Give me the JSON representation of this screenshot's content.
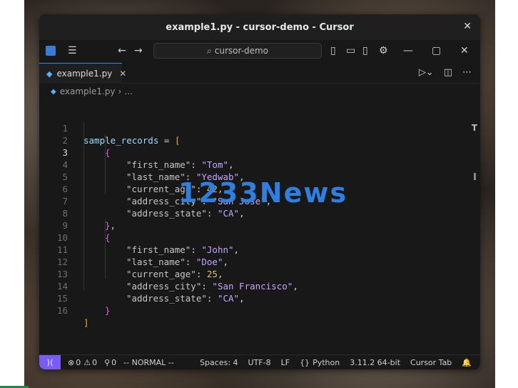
{
  "window": {
    "title": "example1.py - cursor-demo - Cursor"
  },
  "toolbar": {
    "search_label": "cursor-demo"
  },
  "tab": {
    "label": "example1.py"
  },
  "breadcrumb": {
    "file": "example1.py",
    "more": "..."
  },
  "code": {
    "lines": [
      "1",
      "2",
      "3",
      "4",
      "5",
      "6",
      "7",
      "8",
      "9",
      "10",
      "11",
      "12",
      "13",
      "14",
      "15",
      "16"
    ],
    "var": "sample_records",
    "assign": " = ",
    "r1": {
      "k1": "\"first_name\"",
      "v1": "\"Tom\"",
      "k2": "\"last_name\"",
      "v2": "\"Yedwab\"",
      "k3": "\"current_age\"",
      "v3": "42",
      "k4": "\"address_city\"",
      "v4": "\"San Jose\"",
      "k5": "\"address_state\"",
      "v5": "\"CA\""
    },
    "r2": {
      "k1": "\"first_name\"",
      "v1": "\"John\"",
      "k2": "\"last_name\"",
      "v2": "\"Doe\"",
      "k3": "\"current_age\"",
      "v3": "25",
      "k4": "\"address_city\"",
      "v4": "\"San Francisco\"",
      "k5": "\"address_state\"",
      "v5": "\"CA\""
    }
  },
  "watermark": "1233News",
  "status": {
    "errors": "0",
    "warnings": "0",
    "ports": "0",
    "mode": "-- NORMAL --",
    "spaces": "Spaces: 4",
    "encoding": "UTF-8",
    "eol": "LF",
    "language": "Python",
    "interpreter": "3.11.2 64-bit",
    "cursor_tab": "Cursor Tab"
  }
}
